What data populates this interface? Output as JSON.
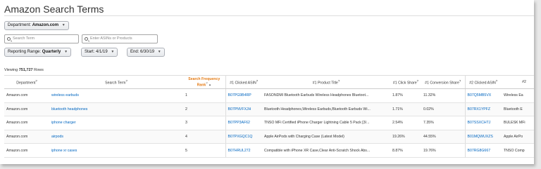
{
  "page": {
    "title": "Amazon Search Terms"
  },
  "filters": {
    "department_label": "Department:",
    "department_value": "Amazon.com",
    "search_term_placeholder": "Search Term",
    "asin_placeholder": "Enter ASINs or Products",
    "reporting_range_label": "Reporting Range:",
    "reporting_range_value": "Quarterly",
    "start_label": "Start:",
    "start_value": "4/1/19",
    "end_label": "End:",
    "end_value": "6/30/19"
  },
  "summary": {
    "viewing_prefix": "Viewing",
    "row_count": "751,727",
    "rows_suffix": "Rows"
  },
  "table": {
    "headers": {
      "department": "Department",
      "search_term": "Search Term",
      "rank": "Search Frequency Rank",
      "clicked_asin_1": "#1 Clicked ASIN",
      "product_title_1": "#1 Product Title",
      "click_share_1": "#1 Click Share",
      "conversion_share_1": "#1 Conversion Share",
      "clicked_asin_2": "#2 Clicked ASIN",
      "product_title_2": "#2"
    },
    "rows": [
      {
        "department": "Amazon.com",
        "search_term": "wireless earbuds",
        "rank": "1",
        "asin1": "B07PG9B4RP",
        "title1": "FASONDMI Bluetooth Earbuds Wireless Headphones Bluetoot...",
        "click1": "1.87%",
        "conv1": "11.32%",
        "asin2": "B07Q5MB5VX",
        "title2": "Wireless Ea"
      },
      {
        "department": "Amazon.com",
        "search_term": "bluetooth headphones",
        "rank": "2",
        "asin1": "B07PNVFXJH",
        "title1": "Bluetooth Headphones,Wireless Earbuds,Bluetooth Earbuds Wi...",
        "click1": "1.71%",
        "conv1": "0.02%",
        "asin2": "B07RX1YPFZ",
        "title2": "Bluetooth E"
      },
      {
        "department": "Amazon.com",
        "search_term": "iphone charger",
        "rank": "3",
        "asin1": "B07PP3AF62",
        "title1": "TNSO MFi Certified iPhone Charger Lightning Cable 5 Pack [3/...",
        "click1": "2.54%",
        "conv1": "7.35%",
        "asin2": "B07SSXCHTJ",
        "title2": "BULESK MFi"
      },
      {
        "department": "Amazon.com",
        "search_term": "airpods",
        "rank": "4",
        "asin1": "B07PXGQC1Q",
        "title1": "Apple AirPods with Charging Case (Latest Model)",
        "click1": "19.26%",
        "conv1": "44.55%",
        "asin2": "B01MQWUXZS",
        "title2": "Apple AirPo"
      },
      {
        "department": "Amazon.com",
        "search_term": "iphone xr cases",
        "rank": "5",
        "asin1": "B07HRUL272",
        "title1": "Compatible with iPhone XR Case,Clear Anti-Scratch Shock Abs...",
        "click1": "8.87%",
        "conv1": "19.76%",
        "asin2": "B07RG8G667",
        "title2": "TNSO Comp"
      }
    ]
  },
  "colors": {
    "link": "#0066c0",
    "highlight": "#e47911"
  }
}
